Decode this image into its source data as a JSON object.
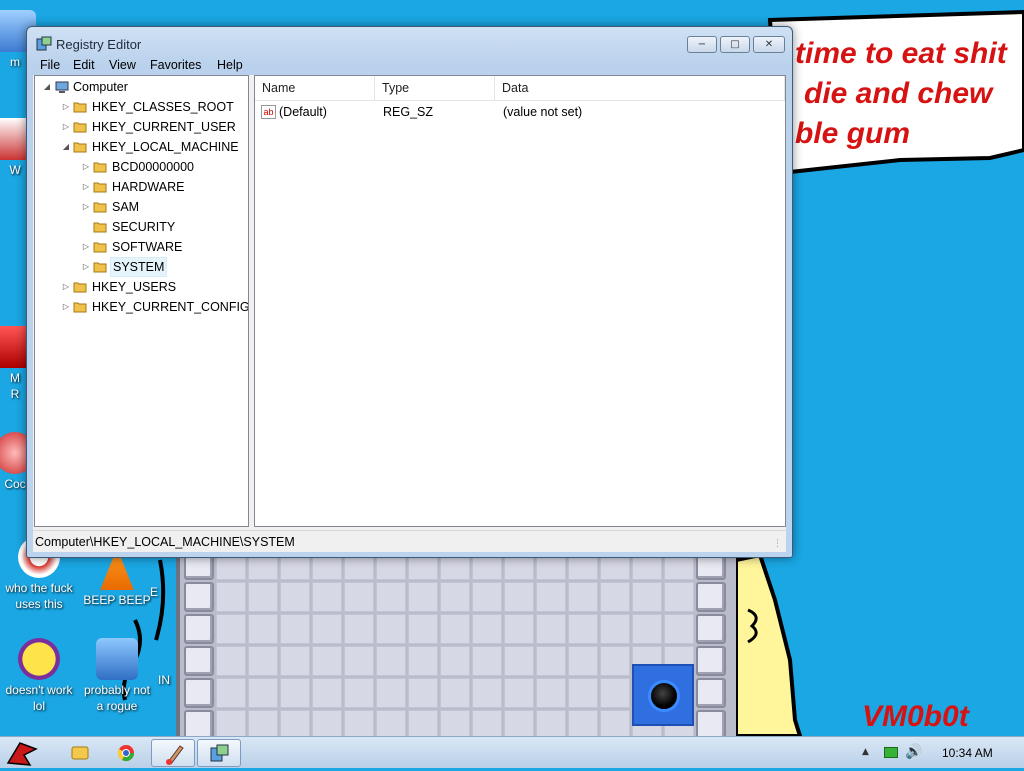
{
  "window": {
    "title": "Registry Editor",
    "min_label": "−",
    "max_label": "□",
    "close_label": "✕"
  },
  "menu": [
    "File",
    "Edit",
    "View",
    "Favorites",
    "Help"
  ],
  "tree": {
    "root": "Computer",
    "hives": [
      "HKEY_CLASSES_ROOT",
      "HKEY_CURRENT_USER",
      "HKEY_LOCAL_MACHINE",
      "HKEY_USERS",
      "HKEY_CURRENT_CONFIG"
    ],
    "hklm_children": [
      "BCD00000000",
      "HARDWARE",
      "SAM",
      "SECURITY",
      "SOFTWARE",
      "SYSTEM"
    ],
    "selected": "SYSTEM"
  },
  "list": {
    "columns": [
      "Name",
      "Type",
      "Data"
    ],
    "rows": [
      {
        "icon": "string-value-icon",
        "icon_text": "ab",
        "name": "(Default)",
        "type": "REG_SZ",
        "data": "(value not set)"
      }
    ]
  },
  "status_bar": "Computer\\HKEY_LOCAL_MACHINE\\SYSTEM",
  "desktop": {
    "speech_lines": [
      "time to eat shit",
      "die and chew",
      "ble gum"
    ],
    "signature": "VM0b0t",
    "icons": [
      {
        "label": "m",
        "icon": "program-icon"
      },
      {
        "label": "W",
        "icon": "program-icon"
      },
      {
        "label": "M",
        "icon": "program-icon"
      },
      {
        "label": "R",
        "icon": "program-icon"
      },
      {
        "label": "Coc",
        "icon": "program-icon"
      },
      {
        "label": "who the fuck uses this",
        "icon": "browser-icon"
      },
      {
        "label": "BEEP BEEP",
        "icon": "traffic-cone-icon"
      },
      {
        "label": "doesn't work lol",
        "icon": "yahoo-messenger-icon"
      },
      {
        "label": "probably not a rogue",
        "icon": "gears-computer-icon"
      },
      {
        "label": "E",
        "icon": "program-icon"
      },
      {
        "label": "IN",
        "icon": "program-icon"
      }
    ]
  },
  "taskbar": {
    "clock": "10:34 AM",
    "pinned": [
      "start-button-icon",
      "explorer-icon",
      "chrome-icon",
      "paint-icon",
      "regedit-icon"
    ]
  },
  "colors": {
    "desktop_bg": "#1aa7e4",
    "speech_text": "#d61212",
    "window_frame": "#bcd3ed"
  }
}
